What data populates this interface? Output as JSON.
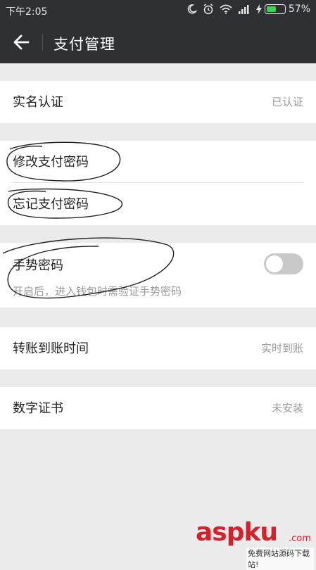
{
  "status_bar": {
    "time": "下午2:05",
    "battery": "57%",
    "battery_level": 0.57,
    "icons": [
      "moon-icon",
      "alarm-icon",
      "wifi-icon",
      "signal-icon",
      "charging-icon",
      "battery-icon"
    ]
  },
  "header": {
    "back_icon": "arrow-left-icon",
    "title": "支付管理"
  },
  "rows": {
    "real_name": {
      "label": "实名认证",
      "value": "已认证"
    },
    "change_password": {
      "label": "修改支付密码"
    },
    "forgot_password": {
      "label": "忘记支付密码"
    },
    "gesture": {
      "label": "手势密码",
      "hint": "开启后，进入钱包时需验证手势密码",
      "enabled": false
    },
    "transfer_time": {
      "label": "转账到账时间",
      "value": "实时到账"
    },
    "certificate": {
      "label": "数字证书",
      "value": "未安装"
    }
  },
  "watermark": {
    "brand": "aspku",
    "dotcom": ".com",
    "subtitle": "免费网站源码下载站!"
  },
  "colors": {
    "header_bg": "#2f3033",
    "page_bg": "#ebebeb",
    "battery_green": "#39d54f",
    "watermark_red": "#d8202a"
  }
}
